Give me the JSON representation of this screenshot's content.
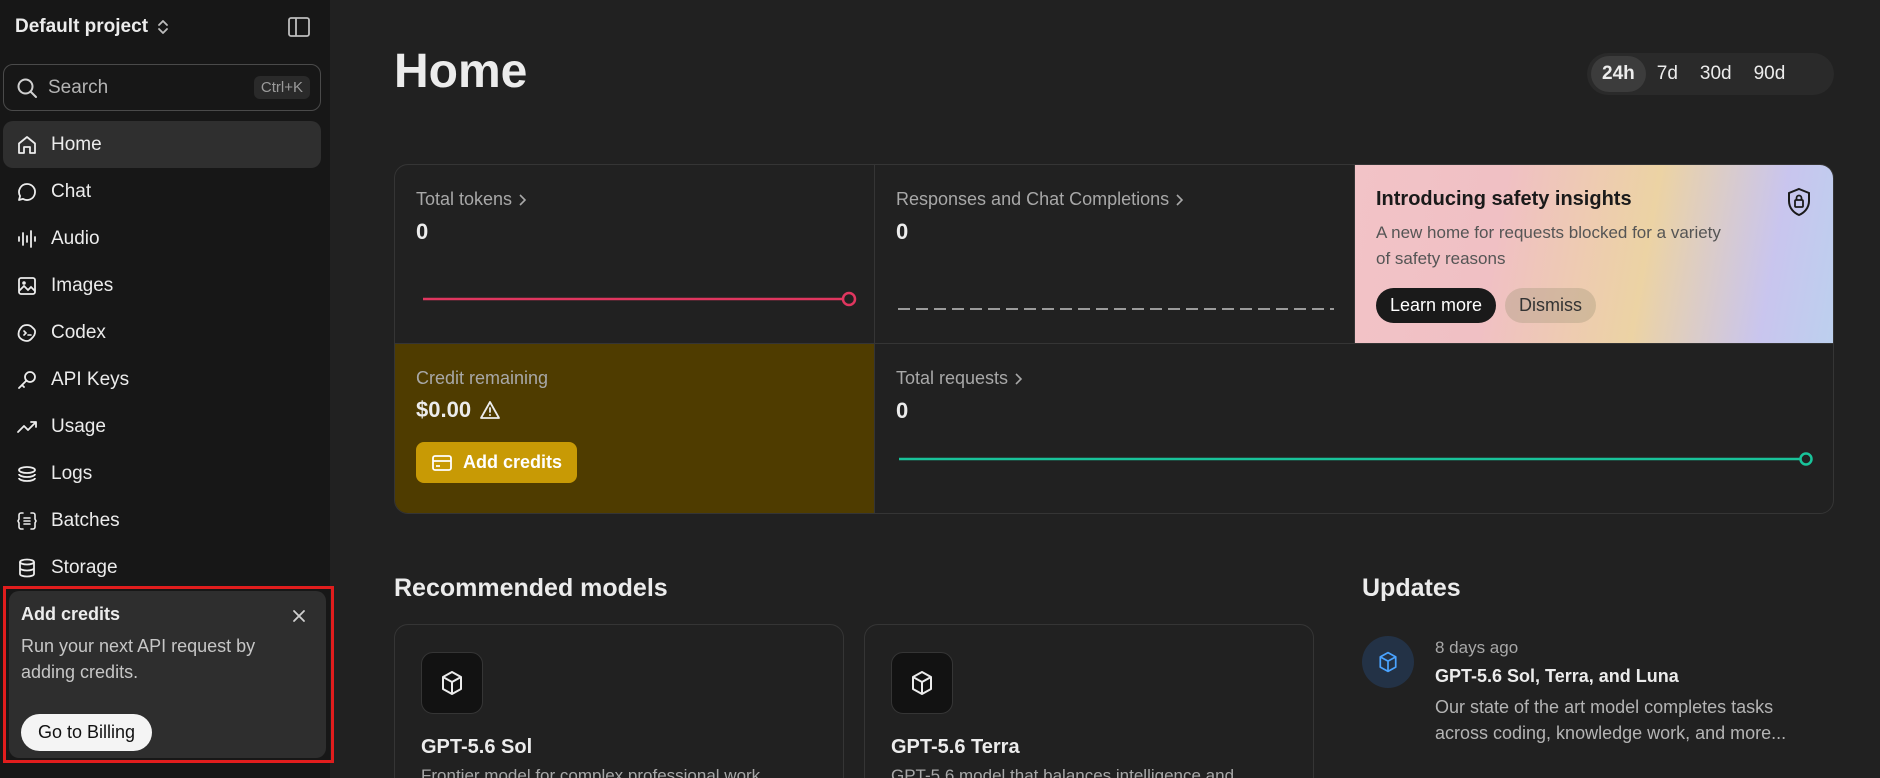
{
  "sidebar": {
    "project_name": "Default project",
    "search": {
      "label": "Search",
      "shortcut": "Ctrl+K"
    },
    "items": [
      {
        "label": "Home",
        "icon": "home-icon",
        "active": true
      },
      {
        "label": "Chat",
        "icon": "chat-icon"
      },
      {
        "label": "Audio",
        "icon": "audio-icon"
      },
      {
        "label": "Images",
        "icon": "images-icon"
      },
      {
        "label": "Codex",
        "icon": "codex-icon"
      },
      {
        "label": "API Keys",
        "icon": "key-icon"
      },
      {
        "label": "Usage",
        "icon": "usage-icon"
      },
      {
        "label": "Logs",
        "icon": "logs-icon"
      },
      {
        "label": "Batches",
        "icon": "batches-icon"
      },
      {
        "label": "Storage",
        "icon": "storage-icon"
      }
    ],
    "promo": {
      "title": "Add credits",
      "text": "Run your next API request by adding credits.",
      "button": "Go to Billing"
    }
  },
  "main": {
    "title": "Home",
    "ranges": [
      "24h",
      "7d",
      "30d",
      "90d"
    ],
    "selected_range": "24h",
    "stats": {
      "total_tokens": {
        "label": "Total tokens",
        "value": "0",
        "color": "#e0365f"
      },
      "responses": {
        "label": "Responses and Chat Completions",
        "value": "0"
      },
      "credit": {
        "label": "Credit remaining",
        "value": "$0.00",
        "button": "Add credits"
      },
      "total_requests": {
        "label": "Total requests",
        "value": "0",
        "color": "#19c39a"
      }
    },
    "safety": {
      "title": "Introducing safety insights",
      "text": "A new home for requests blocked for a variety of safety reasons",
      "learn_more": "Learn more",
      "dismiss": "Dismiss"
    },
    "recommended": {
      "title": "Recommended models",
      "models": [
        {
          "name": "GPT-5.6 Sol",
          "desc": "Frontier model for complex professional work"
        },
        {
          "name": "GPT-5.6 Terra",
          "desc": "GPT-5.6 model that balances intelligence and"
        }
      ]
    },
    "updates": {
      "title": "Updates",
      "items": [
        {
          "time": "8 days ago",
          "title": "GPT-5.6 Sol, Terra, and Luna",
          "desc": "Our state of the art model completes tasks across coding, knowledge work, and more..."
        }
      ]
    }
  }
}
